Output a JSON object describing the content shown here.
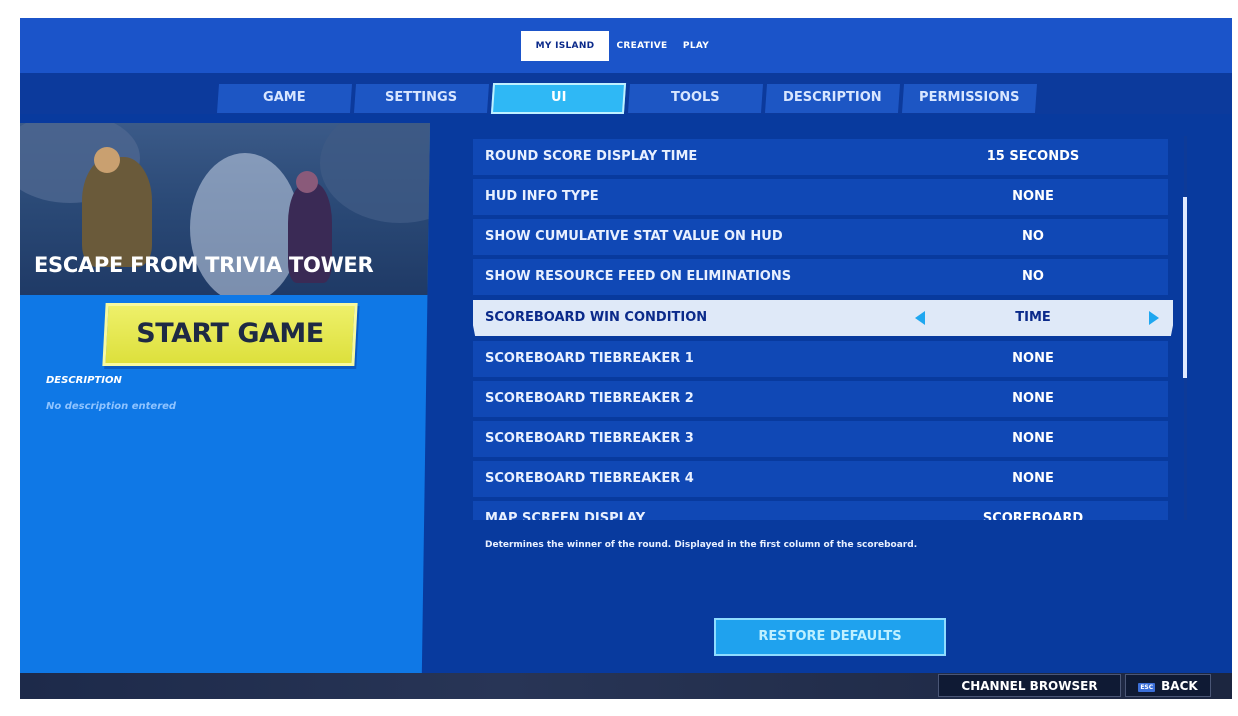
{
  "modes": [
    {
      "label": "MY ISLAND",
      "active": true
    },
    {
      "label": "CREATIVE",
      "active": false
    },
    {
      "label": "PLAY",
      "active": false
    }
  ],
  "tabs": [
    {
      "label": "GAME"
    },
    {
      "label": "SETTINGS"
    },
    {
      "label": "UI",
      "active": true
    },
    {
      "label": "TOOLS"
    },
    {
      "label": "DESCRIPTION"
    },
    {
      "label": "PERMISSIONS"
    }
  ],
  "island": {
    "title": "ESCAPE FROM TRIVIA TOWER",
    "start_label": "START GAME",
    "description_label": "DESCRIPTION",
    "description_text": "No description entered"
  },
  "settings": [
    {
      "label": "ROUND SCORE DISPLAY TIME",
      "value": "15 SECONDS"
    },
    {
      "label": "HUD INFO TYPE",
      "value": "NONE"
    },
    {
      "label": "SHOW CUMULATIVE STAT VALUE ON HUD",
      "value": "NO"
    },
    {
      "label": "SHOW RESOURCE FEED ON ELIMINATIONS",
      "value": "NO"
    },
    {
      "label": "SCOREBOARD WIN CONDITION",
      "value": "TIME",
      "selected": true
    },
    {
      "label": "SCOREBOARD TIEBREAKER 1",
      "value": "NONE"
    },
    {
      "label": "SCOREBOARD TIEBREAKER 2",
      "value": "NONE"
    },
    {
      "label": "SCOREBOARD TIEBREAKER 3",
      "value": "NONE"
    },
    {
      "label": "SCOREBOARD TIEBREAKER 4",
      "value": "NONE"
    },
    {
      "label": "MAP SCREEN DISPLAY",
      "value": "SCOREBOARD"
    }
  ],
  "help_text": "Determines the winner of the round. Displayed in the first column of the scoreboard.",
  "restore_label": "RESTORE DEFAULTS",
  "bottom": {
    "channel_browser": "CHANNEL BROWSER",
    "back_key": "ESC",
    "back_label": "BACK"
  },
  "colors": {
    "background": "#083a9e",
    "accent": "#2fb8f5",
    "start_button": "#e4e64f",
    "panel": "#0f78e6"
  },
  "icons": [
    "left-arrow-icon",
    "right-arrow-icon",
    "esc-key-icon"
  ]
}
